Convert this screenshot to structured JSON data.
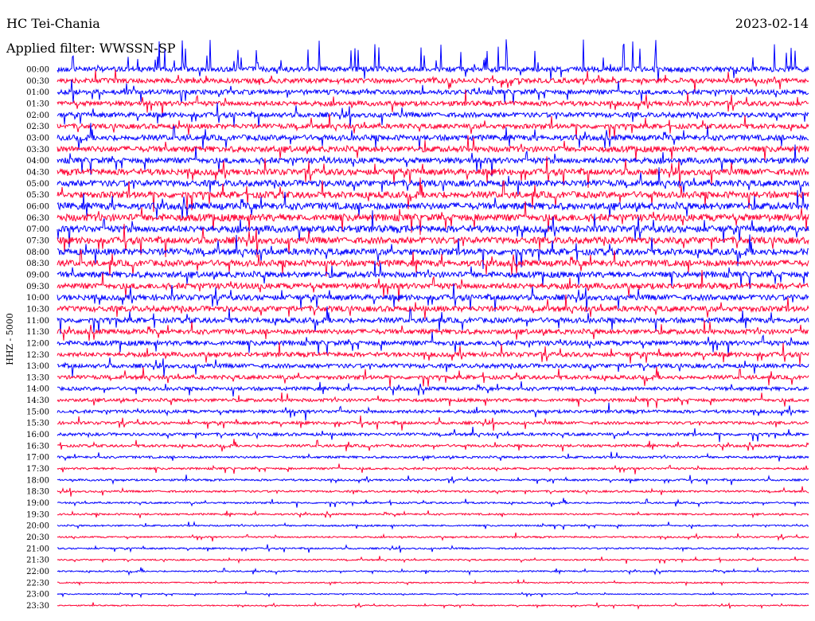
{
  "header": {
    "station": "HC Tei-Chania",
    "date": "2023-02-14",
    "filter": "Applied filter: WWSSN-SP"
  },
  "chart_data": {
    "type": "line",
    "title": "HC Tei-Chania",
    "subtitle": "Applied filter: WWSSN-SP",
    "date": "2023-02-14",
    "ylabel": "HHZ - 5000",
    "xlabel": "",
    "rows": [
      "00:00",
      "00:30",
      "01:00",
      "01:30",
      "02:00",
      "02:30",
      "03:00",
      "03:30",
      "04:00",
      "04:30",
      "05:00",
      "05:30",
      "06:00",
      "06:30",
      "07:00",
      "07:30",
      "08:00",
      "08:30",
      "09:00",
      "09:30",
      "10:00",
      "10:30",
      "11:00",
      "11:30",
      "12:00",
      "12:30",
      "13:00",
      "13:30",
      "14:00",
      "14:30",
      "15:00",
      "15:30",
      "16:00",
      "16:30",
      "17:00",
      "17:30",
      "18:00",
      "18:30",
      "19:00",
      "19:30",
      "20:00",
      "20:30",
      "21:00",
      "21:30",
      "22:00",
      "22:30",
      "23:00",
      "23:30"
    ],
    "row_duration_minutes": 30,
    "colors": [
      "#0000ff",
      "#ff0033"
    ],
    "relative_amplitude": [
      3.2,
      3.0,
      3.0,
      3.0,
      3.0,
      3.0,
      3.4,
      3.6,
      3.6,
      3.8,
      3.8,
      4.0,
      4.2,
      4.4,
      4.2,
      4.0,
      4.0,
      3.8,
      3.6,
      3.6,
      3.4,
      3.4,
      3.2,
      3.0,
      3.0,
      2.8,
      2.6,
      2.4,
      2.2,
      2.0,
      2.0,
      1.8,
      1.8,
      1.6,
      1.4,
      1.3,
      1.2,
      1.2,
      1.1,
      1.1,
      1.0,
      1.0,
      1.0,
      0.9,
      0.9,
      0.8,
      0.7,
      0.7
    ],
    "grid": false,
    "legend": "none"
  }
}
